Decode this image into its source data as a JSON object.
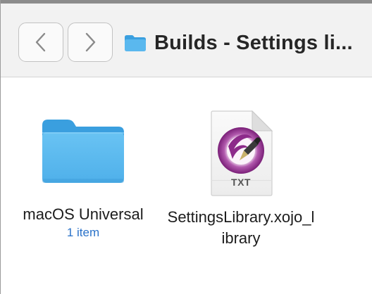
{
  "window": {
    "title": "Builds - Settings li...",
    "title_icon": "folder-icon"
  },
  "toolbar": {
    "back_icon": "chevron-left-icon",
    "forward_icon": "chevron-right-icon"
  },
  "items": [
    {
      "name": "macOS Universal",
      "detail": "1 item",
      "icon": "folder-icon"
    },
    {
      "name": "SettingsLibrary.xojo_library",
      "badge": "TXT",
      "icon": "text-document-icon"
    }
  ],
  "colors": {
    "folder_body": "#5ab8ee",
    "folder_tab": "#3a9fdf",
    "detail_text": "#2a72c9",
    "quill_purple": "#8d2a8a"
  }
}
